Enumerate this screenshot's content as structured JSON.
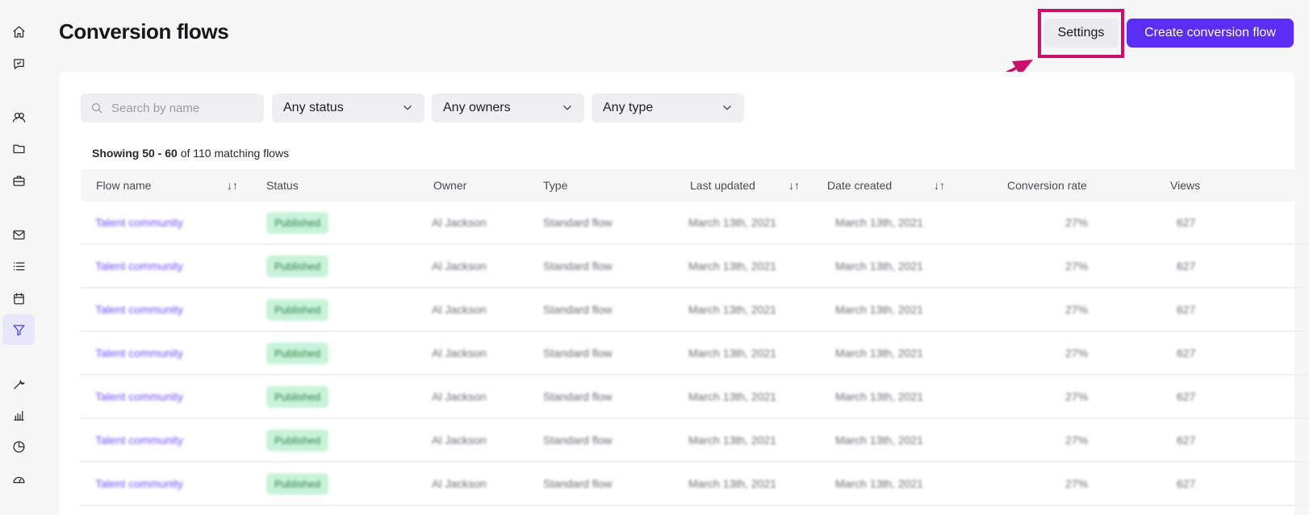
{
  "page": {
    "title": "Conversion flows",
    "settings_label": "Settings",
    "create_label": "Create conversion flow"
  },
  "sidebar": {
    "items": [
      {
        "icon": "home-icon"
      },
      {
        "icon": "chat-icon"
      },
      {
        "icon": "users-icon"
      },
      {
        "icon": "folder-icon"
      },
      {
        "icon": "briefcase-icon"
      },
      {
        "icon": "mail-icon"
      },
      {
        "icon": "list-icon"
      },
      {
        "icon": "calendar-icon"
      },
      {
        "icon": "filter-icon",
        "active": true
      },
      {
        "icon": "wrench-icon"
      },
      {
        "icon": "bar-chart-icon"
      },
      {
        "icon": "pie-chart-icon"
      },
      {
        "icon": "gauge-icon"
      }
    ]
  },
  "filters": {
    "search_placeholder": "Search by name",
    "status": "Any status",
    "owners": "Any owners",
    "type": "Any type"
  },
  "summary": {
    "range": "Showing 50 - 60",
    "rest": "of 110 matching flows"
  },
  "table": {
    "columns": [
      "Flow name",
      "Status",
      "Owner",
      "Type",
      "Last updated",
      "Date created",
      "Conversion rate",
      "Views"
    ],
    "rows": [
      {
        "name": "Talent community",
        "status": "Published",
        "owner": "Al Jackson",
        "type": "Standard flow",
        "updated": "March 13th, 2021",
        "created": "March 13th, 2021",
        "rate": "27%",
        "views": "627"
      },
      {
        "name": "Talent community",
        "status": "Published",
        "owner": "Al Jackson",
        "type": "Standard flow",
        "updated": "March 13th, 2021",
        "created": "March 13th, 2021",
        "rate": "27%",
        "views": "627"
      },
      {
        "name": "Talent community",
        "status": "Published",
        "owner": "Al Jackson",
        "type": "Standard flow",
        "updated": "March 13th, 2021",
        "created": "March 13th, 2021",
        "rate": "27%",
        "views": "627"
      },
      {
        "name": "Talent community",
        "status": "Published",
        "owner": "Al Jackson",
        "type": "Standard flow",
        "updated": "March 13th, 2021",
        "created": "March 13th, 2021",
        "rate": "27%",
        "views": "627"
      },
      {
        "name": "Talent community",
        "status": "Published",
        "owner": "Al Jackson",
        "type": "Standard flow",
        "updated": "March 13th, 2021",
        "created": "March 13th, 2021",
        "rate": "27%",
        "views": "627"
      },
      {
        "name": "Talent community",
        "status": "Published",
        "owner": "Al Jackson",
        "type": "Standard flow",
        "updated": "March 13th, 2021",
        "created": "March 13th, 2021",
        "rate": "27%",
        "views": "627"
      },
      {
        "name": "Talent community",
        "status": "Published",
        "owner": "Al Jackson",
        "type": "Standard flow",
        "updated": "March 13th, 2021",
        "created": "March 13th, 2021",
        "rate": "27%",
        "views": "627"
      }
    ]
  },
  "colors": {
    "accent": "#5b2ef5",
    "highlight": "#c8106b",
    "badge_bg": "#c8f3d8"
  }
}
